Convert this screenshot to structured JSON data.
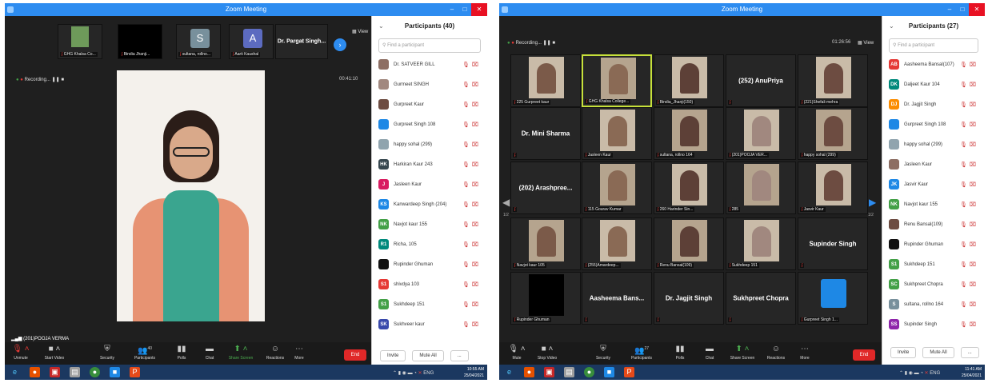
{
  "left": {
    "title": "Zoom Meeting",
    "recording": "Recording...",
    "timer": "00:41:10",
    "view": "View",
    "strip": [
      {
        "label": "GHG Khalsa Co..."
      },
      {
        "label": "Bindia Jhanji..."
      },
      {
        "label": "sultana, rollno...",
        "initial": "S"
      },
      {
        "label": "Aarti Kaushal",
        "initial": "A"
      },
      {
        "label": "Dr. Pargat Singh..."
      }
    ],
    "speaker": "(201)POOJA VERMA",
    "panel_title": "Participants (40)",
    "search_placeholder": "Find a participant",
    "participants": [
      {
        "name": "Dr. SATVEER GILL",
        "badge": "",
        "color": "#8d6e63"
      },
      {
        "name": "Gurmeet SINGH",
        "badge": "",
        "color": "#a1887f"
      },
      {
        "name": "Gurpreet Kaur",
        "badge": "",
        "color": "#6d4c41"
      },
      {
        "name": "Gurpreet Singh 108",
        "badge": "",
        "color": "#1e88e5"
      },
      {
        "name": "happy sohal (299)",
        "badge": "",
        "color": "#90a4ae"
      },
      {
        "name": "Harkiran Kaur 243",
        "badge": "HK",
        "color": "#37474f"
      },
      {
        "name": "Jasleen Kaur",
        "badge": "J",
        "color": "#d81b60"
      },
      {
        "name": "Kanwardeep Singh (204)",
        "badge": "KS",
        "color": "#1e88e5"
      },
      {
        "name": "Navjot kaur 155",
        "badge": "NK",
        "color": "#43a047"
      },
      {
        "name": "Richa, 105",
        "badge": "R1",
        "color": "#00897b"
      },
      {
        "name": "Rupinder Ghuman",
        "badge": "",
        "color": "#111111"
      },
      {
        "name": "shivdya 103",
        "badge": "S1",
        "color": "#e53935"
      },
      {
        "name": "Sukhdeep 151",
        "badge": "S1",
        "color": "#43a047"
      },
      {
        "name": "Sukhveer kaur",
        "badge": "SK",
        "color": "#3949ab"
      }
    ],
    "invite": "Invite",
    "mute_all": "Mute All",
    "more": "...",
    "toolbar": {
      "unmute": "Unmute",
      "start_video": "Start Video",
      "security": "Security",
      "participants": "Participants",
      "participants_count": "40",
      "polls": "Polls",
      "chat": "Chat",
      "share": "Share Screen",
      "reactions": "Reactions",
      "more": "More",
      "end": "End"
    },
    "clock": {
      "time": "10:55 AM",
      "date": "25/04/2021"
    }
  },
  "right": {
    "title": "Zoom Meeting",
    "recording": "Recording...",
    "timer": "01:26:56",
    "view": "View",
    "panel_title": "Participants (27)",
    "search_placeholder": "Find a participant",
    "page_left": "1/2",
    "page_right": "1/2",
    "tiles": [
      {
        "label": "225 Gurpreet kaur",
        "type": "video"
      },
      {
        "label": "GHG Khalsa College...",
        "type": "video"
      },
      {
        "label": "Bindia_Jhanji(150)",
        "type": "video"
      },
      {
        "label": "(252) AnuPriya",
        "type": "name"
      },
      {
        "label": "(221)Shefali mehra",
        "type": "video"
      },
      {
        "label": "Dr. Mini Sharma",
        "type": "name"
      },
      {
        "label": "Jasleen Kaur",
        "type": "video"
      },
      {
        "label": "sultana, rollno 164",
        "type": "video"
      },
      {
        "label": "(201)POOJA VER...",
        "type": "video"
      },
      {
        "label": "happy sohal (299)",
        "type": "video"
      },
      {
        "label": "(202) Arashpree...",
        "type": "name"
      },
      {
        "label": "115 Gourav Kumar",
        "type": "video"
      },
      {
        "label": "260 Harinder Sin...",
        "type": "video"
      },
      {
        "label": "285",
        "type": "video"
      },
      {
        "label": "Jasvir Kaur",
        "type": "video"
      },
      {
        "label": "Navjot kaur 105",
        "type": "video"
      },
      {
        "label": "(255)Amardeep...",
        "type": "video"
      },
      {
        "label": "Renu Bansal(109)",
        "type": "video"
      },
      {
        "label": "Sukhdeep 151",
        "type": "video"
      },
      {
        "label": "Supinder Singh",
        "type": "name"
      },
      {
        "label": "Rupinder Ghuman",
        "type": "video"
      },
      {
        "label": "Aasheema Bans...",
        "type": "name"
      },
      {
        "label": "Dr. Jagjit Singh",
        "type": "name"
      },
      {
        "label": "Sukhpreet Chopra",
        "type": "name"
      },
      {
        "label": "Gurpreet Singh 1...",
        "type": "avatar"
      }
    ],
    "participants": [
      {
        "name": "Aasheema Bansal(107)",
        "badge": "AB",
        "color": "#e53935"
      },
      {
        "name": "Daljeet Kaur 104",
        "badge": "DK",
        "color": "#00897b"
      },
      {
        "name": "Dr. Jagjit Singh",
        "badge": "DJ",
        "color": "#fb8c00"
      },
      {
        "name": "Gurpreet Singh 108",
        "badge": "",
        "color": "#1e88e5"
      },
      {
        "name": "happy sohal (299)",
        "badge": "",
        "color": "#90a4ae"
      },
      {
        "name": "Jasleen Kaur",
        "badge": "",
        "color": "#8d6e63"
      },
      {
        "name": "Jasvir Kaur",
        "badge": "JK",
        "color": "#1e88e5"
      },
      {
        "name": "Navjot kaur 155",
        "badge": "NK",
        "color": "#43a047"
      },
      {
        "name": "Renu Bansal(109)",
        "badge": "",
        "color": "#6d4c41"
      },
      {
        "name": "Rupinder Ghuman",
        "badge": "",
        "color": "#111111"
      },
      {
        "name": "Sukhdeep 151",
        "badge": "S1",
        "color": "#43a047"
      },
      {
        "name": "Sukhpreet Chopra",
        "badge": "SC",
        "color": "#43a047"
      },
      {
        "name": "sultana, rollno 164",
        "badge": "S",
        "color": "#78909c"
      },
      {
        "name": "Supinder Singh",
        "badge": "SS",
        "color": "#8e24aa"
      }
    ],
    "invite": "Invite",
    "mute_all": "Mute All",
    "more": "...",
    "toolbar": {
      "mute": "Mute",
      "stop_video": "Stop Video",
      "security": "Security",
      "participants": "Participants",
      "participants_count": "27",
      "polls": "Polls",
      "chat": "Chat",
      "share": "Share Screen",
      "reactions": "Reactions",
      "more": "More",
      "end": "End"
    },
    "clock": {
      "time": "11:41 AM",
      "date": "25/04/2021"
    }
  },
  "taskbar": {
    "lang": "ENG"
  }
}
